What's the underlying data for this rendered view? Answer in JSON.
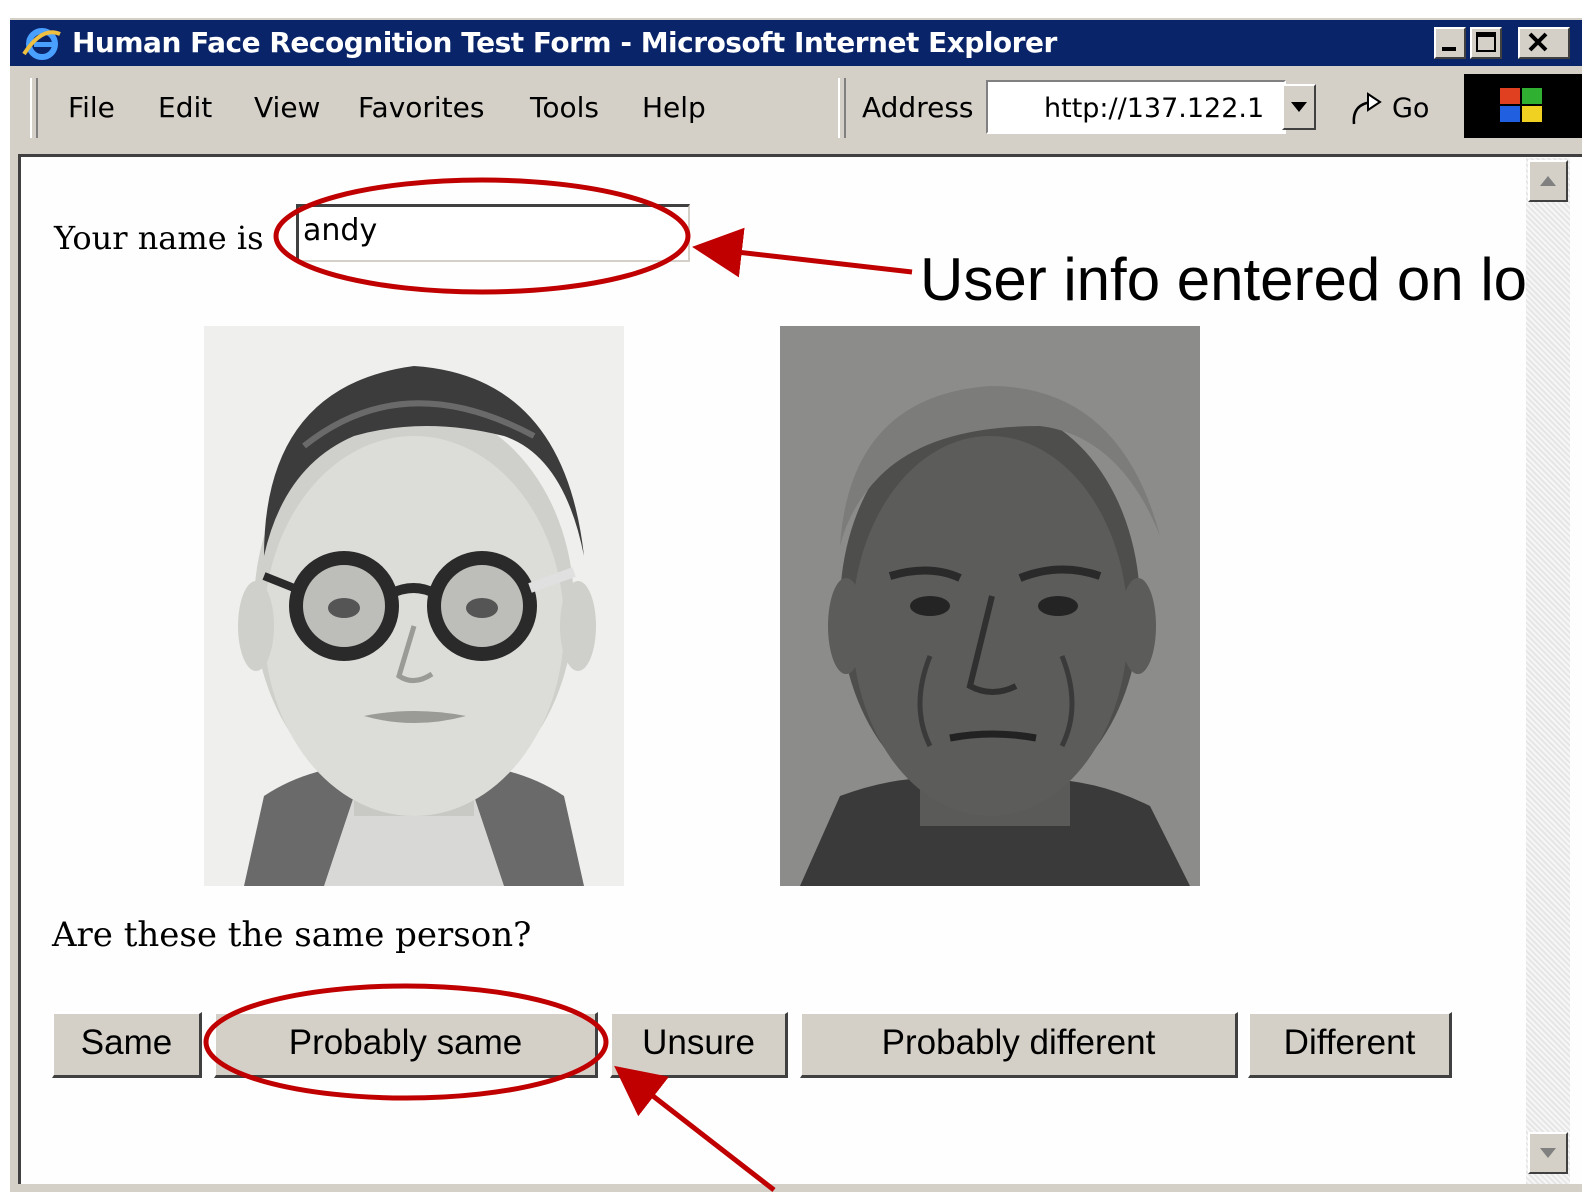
{
  "window": {
    "title": "Human Face Recognition Test Form - Microsoft Internet Explorer",
    "controls": [
      "minimize-icon",
      "maximize-icon",
      "close-icon"
    ]
  },
  "menubar": {
    "items": [
      "File",
      "Edit",
      "View",
      "Favorites",
      "Tools",
      "Help"
    ],
    "address_label": "Address",
    "address_value": "http://137.122.1",
    "go_label": "Go"
  },
  "form": {
    "name_label": "Your name is",
    "name_value": "andy",
    "question": "Are these the same person?",
    "buttons": [
      "Same",
      "Probably same",
      "Unsure",
      "Probably different",
      "Different"
    ]
  },
  "annotations": {
    "callout_text": "User info entered on lo",
    "highlight_color": "#c00000"
  },
  "images": {
    "photo1": "portrait-young-man-glasses",
    "photo2": "portrait-old-man"
  },
  "colors": {
    "titlebar": "#0a246a",
    "chrome": "#d4d0c8",
    "annotation": "#c00000"
  }
}
